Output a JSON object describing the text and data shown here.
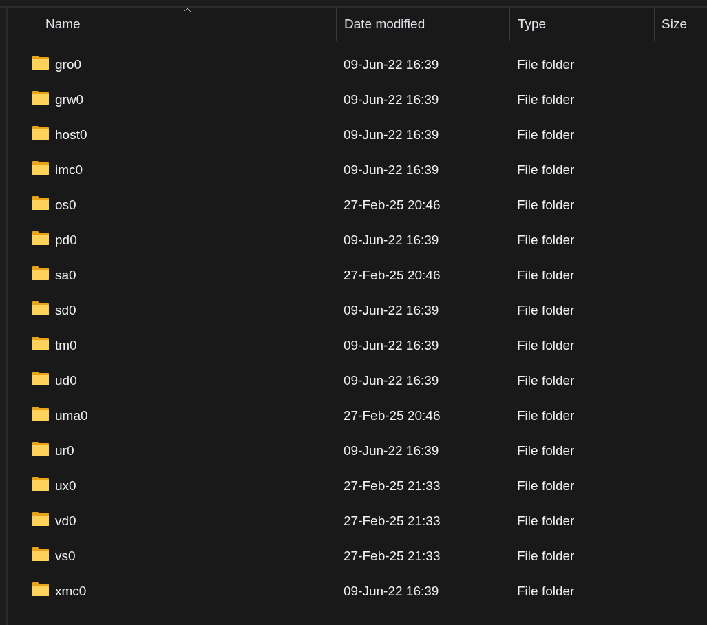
{
  "table": {
    "columns": [
      {
        "label": "Name",
        "sorted": true
      },
      {
        "label": "Date modified",
        "sorted": false
      },
      {
        "label": "Type",
        "sorted": false
      },
      {
        "label": "Size",
        "sorted": false
      }
    ],
    "rows": [
      {
        "name": "gro0",
        "date": "09-Jun-22 16:39",
        "type": "File folder"
      },
      {
        "name": "grw0",
        "date": "09-Jun-22 16:39",
        "type": "File folder"
      },
      {
        "name": "host0",
        "date": "09-Jun-22 16:39",
        "type": "File folder"
      },
      {
        "name": "imc0",
        "date": "09-Jun-22 16:39",
        "type": "File folder"
      },
      {
        "name": "os0",
        "date": "27-Feb-25 20:46",
        "type": "File folder"
      },
      {
        "name": "pd0",
        "date": "09-Jun-22 16:39",
        "type": "File folder"
      },
      {
        "name": "sa0",
        "date": "27-Feb-25 20:46",
        "type": "File folder"
      },
      {
        "name": "sd0",
        "date": "09-Jun-22 16:39",
        "type": "File folder"
      },
      {
        "name": "tm0",
        "date": "09-Jun-22 16:39",
        "type": "File folder"
      },
      {
        "name": "ud0",
        "date": "09-Jun-22 16:39",
        "type": "File folder"
      },
      {
        "name": "uma0",
        "date": "27-Feb-25 20:46",
        "type": "File folder"
      },
      {
        "name": "ur0",
        "date": "09-Jun-22 16:39",
        "type": "File folder"
      },
      {
        "name": "ux0",
        "date": "27-Feb-25 21:33",
        "type": "File folder"
      },
      {
        "name": "vd0",
        "date": "27-Feb-25 21:33",
        "type": "File folder"
      },
      {
        "name": "vs0",
        "date": "27-Feb-25 21:33",
        "type": "File folder"
      },
      {
        "name": "xmc0",
        "date": "09-Jun-22 16:39",
        "type": "File folder"
      }
    ]
  }
}
